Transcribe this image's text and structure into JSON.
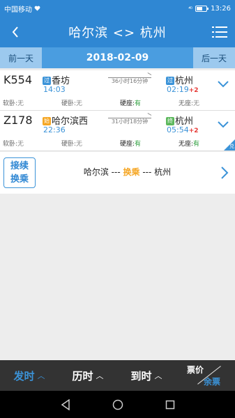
{
  "status_bar": {
    "carrier": "中国移动",
    "signal": "⁴ᴳ",
    "battery_level": 0.6,
    "time": "13:26"
  },
  "nav": {
    "title": "哈尔滨 <> 杭州",
    "back_icon": "back-arrow-icon",
    "menu_icon": "list-menu-icon"
  },
  "date_bar": {
    "prev_label": "前一天",
    "date": "2018-02-09",
    "next_label": "后一天"
  },
  "trains": [
    {
      "number": "K554",
      "from_tag": "过",
      "from": "香坊",
      "dep_time": "14:03",
      "duration": "36小时16分钟",
      "to_tag": "过",
      "to": "杭州",
      "arr_time": "02:19",
      "day_offset": "+2",
      "seats": [
        {
          "label": "软卧:",
          "value": "无"
        },
        {
          "label": "硬卧:",
          "value": "无"
        },
        {
          "label": "硬座:",
          "value": "有"
        },
        {
          "label": "无座:",
          "value": "无"
        }
      ],
      "corner_badge": ""
    },
    {
      "number": "Z178",
      "from_tag": "始",
      "from": "哈尔滨西",
      "dep_time": "22:36",
      "duration": "31小时18分钟",
      "to_tag": "终",
      "to": "杭州",
      "arr_time": "05:54",
      "day_offset": "+2",
      "seats": [
        {
          "label": "软卧:",
          "value": "无"
        },
        {
          "label": "硬卧:",
          "value": "无"
        },
        {
          "label": "硬座:",
          "value": "有"
        },
        {
          "label": "无座:",
          "value": "有"
        }
      ],
      "corner_badge": "兑"
    }
  ],
  "transfer": {
    "badge_line1": "接续",
    "badge_line2": "换乘",
    "from": "哈尔滨 ---",
    "middle": "换乘",
    "to": "--- 杭州"
  },
  "bottom_bar": {
    "sort_depart": "发时",
    "sort_duration": "历时",
    "sort_arrive": "到时",
    "price_label": "票价",
    "remain_label": "余票",
    "active_color": "#3b93d8"
  }
}
